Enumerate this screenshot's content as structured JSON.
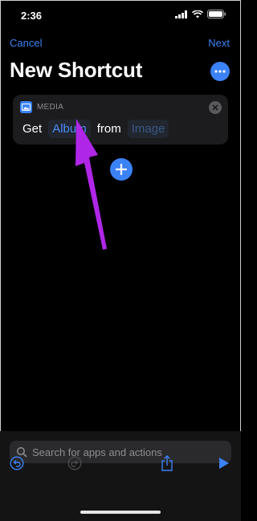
{
  "status_bar": {
    "time": "2:36",
    "icons": [
      "signal-icon",
      "wifi-icon",
      "battery-icon"
    ]
  },
  "nav": {
    "cancel_label": "Cancel",
    "next_label": "Next"
  },
  "page": {
    "title": "New Shortcut"
  },
  "action_card": {
    "category_label": "MEDIA",
    "verb": "Get",
    "parameter": "Album",
    "preposition": "from",
    "input_placeholder": "Image"
  },
  "search": {
    "placeholder": "Search for apps and actions"
  },
  "toolbar": {
    "icons": [
      "undo-icon",
      "redo-icon",
      "share-icon",
      "play-icon"
    ]
  },
  "colors": {
    "accent": "#3b82f6",
    "annotation_arrow": "#b026e8",
    "background": "#000000",
    "card": "#1c1c1e"
  }
}
